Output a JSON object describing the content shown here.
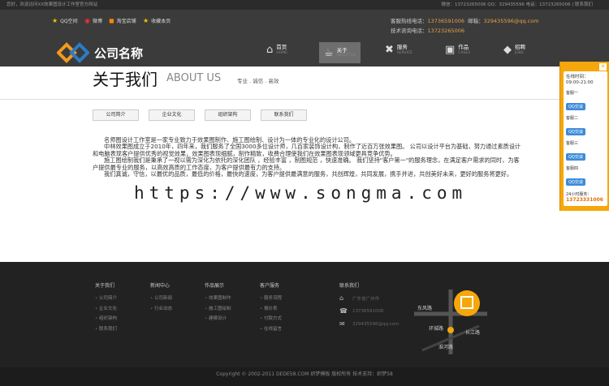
{
  "topbar": {
    "welcome": "您好，欢迎访问XX效果图设计工作室官方网站",
    "right": "微信：13723265006  QQ：329435596  电话：13723265006 | 联系我们"
  },
  "favs": [
    {
      "icon": "star-icon",
      "label": "QQ空间"
    },
    {
      "icon": "weibo-icon",
      "label": "微博"
    },
    {
      "icon": "rss-icon",
      "label": "淘宝店铺"
    },
    {
      "icon": "star-icon",
      "label": "收藏本页"
    }
  ],
  "contact": {
    "line1_label": "客服热线电话：",
    "line1_value": "13736591006",
    "mail_label": "邮箱：",
    "mail_value": "329435596@qq.com",
    "line2_label": "技术咨询电话：",
    "line2_value": "13723265006"
  },
  "logo": {
    "text": "公司名称"
  },
  "nav": [
    {
      "icon": "home-icon",
      "cn": "首页",
      "en": "HOME"
    },
    {
      "icon": "cup-icon",
      "cn": "关于",
      "en": "ABOUT US"
    },
    {
      "icon": "tools-icon",
      "cn": "服务",
      "en": "SERVICE"
    },
    {
      "icon": "camera-icon",
      "cn": "作品",
      "en": "CASES"
    },
    {
      "icon": "box-icon",
      "cn": "招聘",
      "en": "JOBS"
    }
  ],
  "page": {
    "title": "关于我们",
    "english": "ABOUT US",
    "slogan": "专业 . 诚信 . 高效"
  },
  "tabs": [
    "公司简介",
    "企业文化",
    "组织架构",
    "联系我们"
  ],
  "content": [
    "名师图设计工作室是一家专业致力于效果图制作、施工图绘制、设计为一体的专业化的设计公司。",
    "中林效果图成立于2010年，四年来，我们服务了全国3000多位设计师，几百家装饰设计构，制作了近百万张效果图。 公司以设计平台为基础，努力通过素质设计和电脑表现客户提供优秀的视觉效果，效果图表现细腻，制作精致，收费合理使我们在效果图表现领域更具竞争优势。",
    "施工图绘制我们是秉承了一视以需为深化为依托的深化团队 ，经验丰富 ，制图规范 ，快速准确。 我们坚持\"客户第一\"的服务理念，在满足客户需求的同时，为客户提供最专业的服务，以高效高质的工作态度，为客户提供最有力的支持。",
    "我们真诚，守信，以最优的品质，最低的价格，最快的速度，为客户提供最满意的服务，共创辉煌，共同发展，携手并进，共创美好未来，更好的服务将更好。"
  ],
  "watermark": "https://www.songma.com",
  "footer": {
    "cols": [
      {
        "title": "关于我们",
        "items": [
          "公司简介",
          "企业文化",
          "组织架构",
          "联系我们"
        ]
      },
      {
        "title": "新闻中心",
        "items": [
          "公司新闻",
          "行业动态"
        ]
      },
      {
        "title": "作品展示",
        "items": [
          "效果图制作",
          "施工图绘制",
          "建模设计"
        ]
      },
      {
        "title": "客户服务",
        "items": [
          "服务流程",
          "报价表",
          "付款方式",
          "在线留言"
        ]
      }
    ],
    "links_title": "联系我们",
    "links": [
      {
        "icon": "home-icon",
        "text": "广东省广州市"
      },
      {
        "icon": "phone-icon",
        "text": "13736591006"
      },
      {
        "icon": "mail-icon",
        "text": "329435596@qq.com"
      }
    ],
    "map": {
      "road1": "东风路",
      "road2": "环城路",
      "road3": "淮河路",
      "road4": "长江路"
    },
    "copyright": "Copyright © 2002-2011 DEDE58.COM 织梦模板 版权所有    技术支持：织梦58"
  },
  "qq": {
    "hours_label": "在线时间：",
    "hours": "09:00-21:00",
    "agents": [
      "客服一",
      "客服二",
      "客服三",
      "客服四"
    ],
    "btn": "QQ交谈",
    "tel_label": "24小时服务：",
    "tel": "13723331006"
  }
}
